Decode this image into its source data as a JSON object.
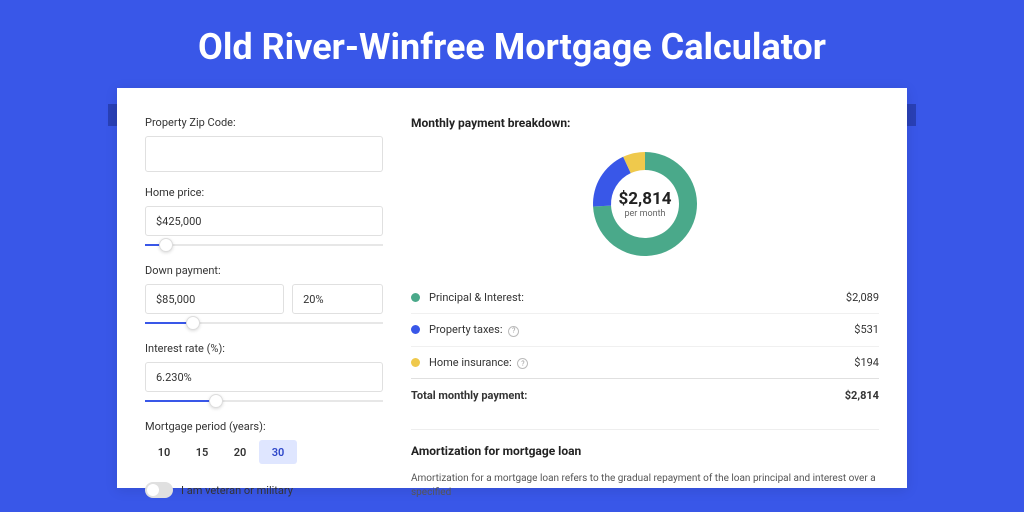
{
  "page": {
    "title": "Old River-Winfree Mortgage Calculator"
  },
  "form": {
    "zip": {
      "label": "Property Zip Code:",
      "value": ""
    },
    "home_price": {
      "label": "Home price:",
      "value": "$425,000",
      "slider_pct": 9
    },
    "down_payment": {
      "label": "Down payment:",
      "amount": "$85,000",
      "percent": "20%",
      "slider_pct": 20
    },
    "interest_rate": {
      "label": "Interest rate (%):",
      "value": "6.230%",
      "slider_pct": 30
    },
    "period": {
      "label": "Mortgage period (years):",
      "options": [
        "10",
        "15",
        "20",
        "30"
      ],
      "selected": "30"
    },
    "veteran": {
      "label": "I am veteran or military",
      "checked": false
    }
  },
  "breakdown": {
    "title": "Monthly payment breakdown:",
    "center_amount": "$2,814",
    "center_sub": "per month",
    "items": [
      {
        "label": "Principal & Interest:",
        "value": "$2,089",
        "num": 2089,
        "color": "#4aa98a",
        "help": false
      },
      {
        "label": "Property taxes:",
        "value": "$531",
        "num": 531,
        "color": "#3957e8",
        "help": true
      },
      {
        "label": "Home insurance:",
        "value": "$194",
        "num": 194,
        "color": "#efc94c",
        "help": true
      }
    ],
    "total_label": "Total monthly payment:",
    "total_value": "$2,814"
  },
  "amort": {
    "title": "Amortization for mortgage loan",
    "desc": "Amortization for a mortgage loan refers to the gradual repayment of the loan principal and interest over a specified"
  },
  "chart_data": {
    "type": "pie",
    "title": "Monthly payment breakdown",
    "series": [
      {
        "name": "Principal & Interest",
        "value": 2089,
        "color": "#4aa98a"
      },
      {
        "name": "Property taxes",
        "value": 531,
        "color": "#3957e8"
      },
      {
        "name": "Home insurance",
        "value": 194,
        "color": "#efc94c"
      }
    ],
    "total": 2814,
    "center_label": "$2,814 per month"
  }
}
